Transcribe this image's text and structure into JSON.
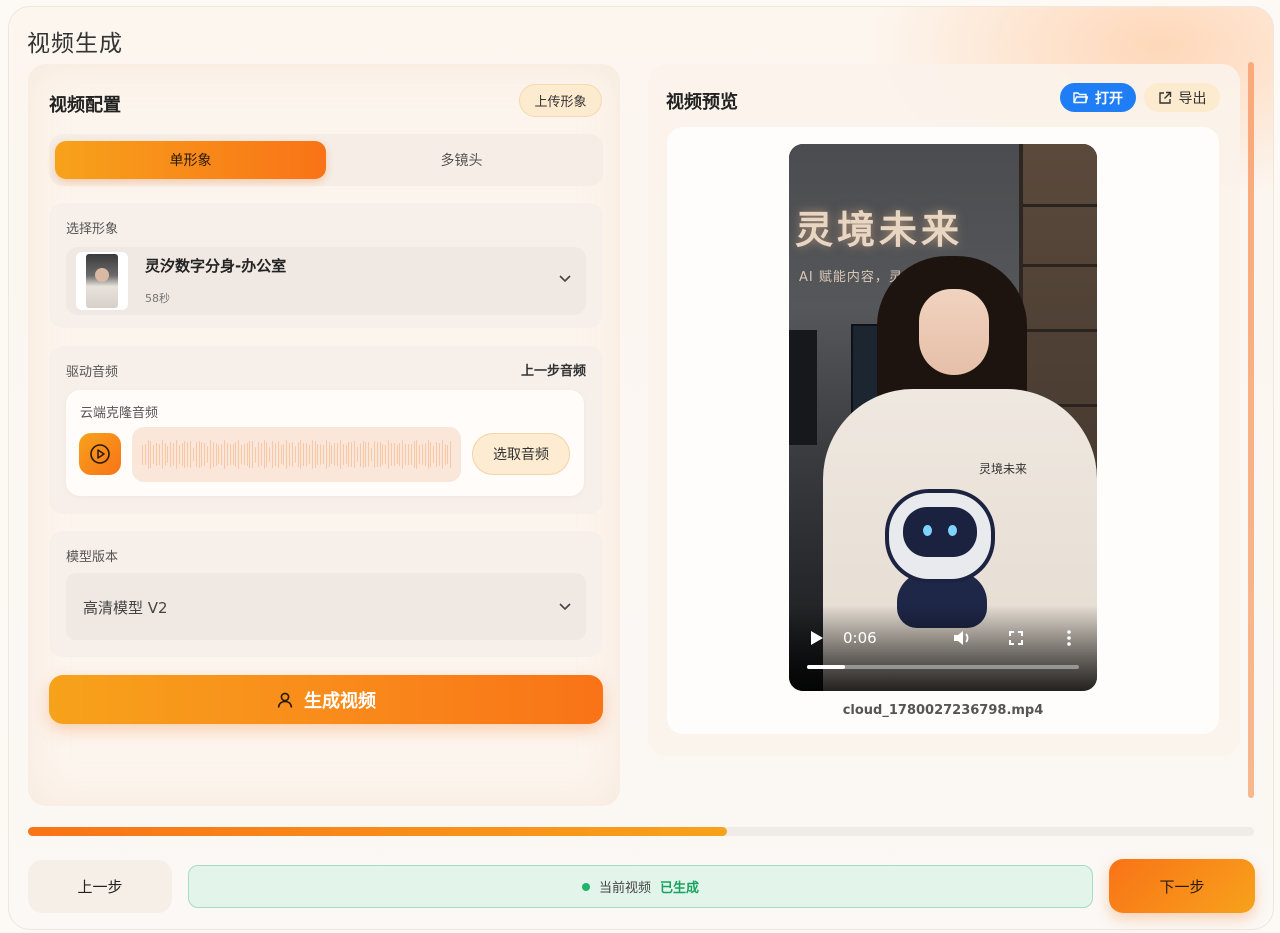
{
  "page": {
    "title": "视频生成"
  },
  "config": {
    "title": "视频配置",
    "upload_label": "上传形象",
    "tabs": [
      {
        "label": "单形象",
        "active": true
      },
      {
        "label": "多镜头",
        "active": false
      }
    ],
    "avatar": {
      "label": "选择形象",
      "name": "灵汐数字分身-办公室",
      "duration": "58秒"
    },
    "audio": {
      "label": "驱动音频",
      "prev_audio_label": "上一步音频",
      "source_label": "云端克隆音频",
      "pick_label": "选取音频"
    },
    "model": {
      "label": "模型版本",
      "value": "高清模型 V2"
    },
    "generate_label": "生成视频"
  },
  "preview": {
    "title": "视频预览",
    "open_label": "打开",
    "export_label": "导出",
    "video": {
      "sign_text": "灵境未来",
      "slogan_text": "AI 赋能内容，灵境创",
      "hoodie_text": "灵境未来",
      "time": "0:06",
      "progress": 0.14
    },
    "file_name": "cloud_1780027236798.mp4"
  },
  "footer": {
    "progress": 0.57,
    "prev_label": "上一步",
    "status_label": "当前视频",
    "status_value": "已生成",
    "next_label": "下一步"
  },
  "colors": {
    "accent": "#f97317",
    "accent_light": "#f7a21b",
    "blue": "#1f7ef5",
    "success": "#18a460"
  }
}
